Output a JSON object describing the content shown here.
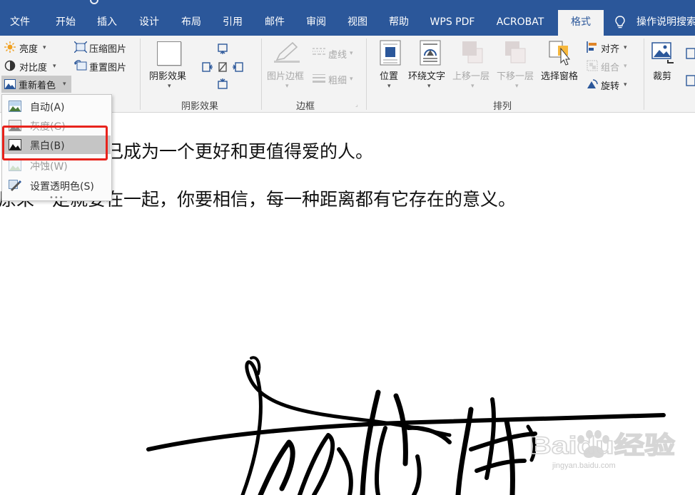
{
  "tabs": [
    {
      "label": "文件"
    },
    {
      "label": "开始"
    },
    {
      "label": "插入"
    },
    {
      "label": "设计"
    },
    {
      "label": "布局"
    },
    {
      "label": "引用"
    },
    {
      "label": "邮件"
    },
    {
      "label": "审阅"
    },
    {
      "label": "视图"
    },
    {
      "label": "帮助"
    },
    {
      "label": "WPS PDF"
    },
    {
      "label": "ACROBAT"
    },
    {
      "label": "格式",
      "active": true
    }
  ],
  "tell_me": "操作说明搜索",
  "ribbon": {
    "adjust": {
      "brightness": "亮度",
      "contrast": "对比度",
      "recolor": "重新着色",
      "compress": "压缩图片",
      "reset": "重置图片"
    },
    "shadow": {
      "shadow_effects": "阴影效果",
      "group_label": "阴影效果"
    },
    "border": {
      "picture_border": "图片边框",
      "dashes": "虚线",
      "weight": "粗细",
      "group_label": "边框"
    },
    "arrange": {
      "position": "位置",
      "wrap_text": "环绕文字",
      "bring_forward": "上移一层",
      "send_backward": "下移一层",
      "selection_pane": "选择窗格",
      "align": "对齐",
      "group": "组合",
      "rotate": "旋转",
      "group_label": "排列"
    },
    "size": {
      "crop": "裁剪"
    }
  },
  "recolor_menu": [
    {
      "label": "自动(A)",
      "icon": "picture-auto-icon"
    },
    {
      "label": "灰度(G)",
      "icon": "picture-grayscale-icon"
    },
    {
      "label": "黑白(B)",
      "icon": "picture-blackwhite-icon",
      "highlighted": true
    },
    {
      "label": "冲蚀(W)",
      "icon": "picture-washout-icon"
    },
    {
      "label": "设置透明色(S)",
      "icon": "set-transparent-icon"
    }
  ],
  "document": {
    "line1": "己成为一个更好和更值得爱的人。",
    "line2": "原来一定就要在一起，你要相信，每一种距离都有它存在的意义。"
  },
  "watermark": {
    "brand": "Baidu经验",
    "url": "jingyan.baidu.com"
  },
  "colors": {
    "accent": "#2b579a",
    "ribbon_bg": "#f3f3f3",
    "highlight_border": "#e8231c"
  }
}
